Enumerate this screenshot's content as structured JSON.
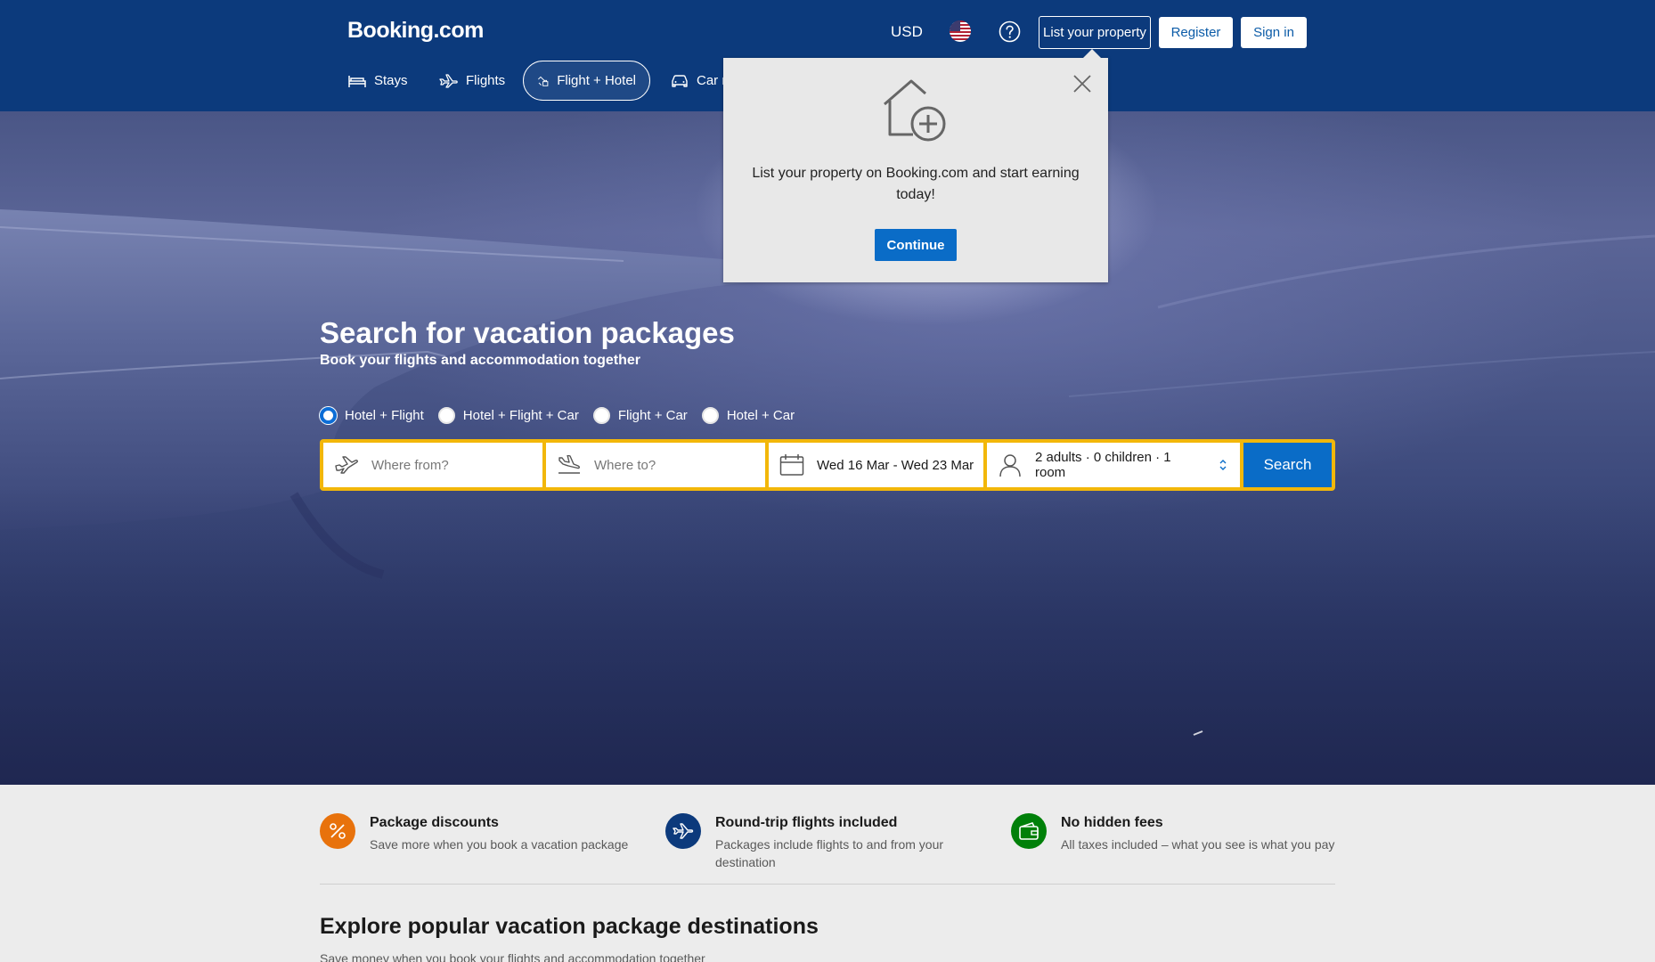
{
  "header": {
    "logo": "Booking.com",
    "currency": "USD",
    "list_property_label": "List your property",
    "register_label": "Register",
    "signin_label": "Sign in"
  },
  "nav": {
    "tabs": [
      {
        "label": "Stays",
        "icon": "bed-icon"
      },
      {
        "label": "Flights",
        "icon": "plane-icon"
      },
      {
        "label": "Flight + Hotel",
        "icon": "flight-hotel-icon",
        "active": true
      },
      {
        "label": "Car r",
        "icon": "car-icon"
      }
    ]
  },
  "popup": {
    "text": "List your property on Booking.com and start earning today!",
    "continue_label": "Continue"
  },
  "hero": {
    "title": "Search for vacation packages",
    "subtitle": "Book your flights and accommodation together",
    "options": [
      "Hotel + Flight",
      "Hotel + Flight + Car",
      "Flight + Car",
      "Hotel + Car"
    ],
    "selected_option": "Hotel + Flight"
  },
  "search": {
    "from_placeholder": "Where from?",
    "to_placeholder": "Where to?",
    "dates": "Wed 16 Mar - Wed 23 Mar",
    "guests": "2 adults · 0 children · 1 room",
    "search_label": "Search"
  },
  "features": [
    {
      "title": "Package discounts",
      "desc": "Save more when you book a vacation package",
      "color": "#e8720c"
    },
    {
      "title": "Round-trip flights included",
      "desc": "Packages include flights to and from your destination",
      "color": "#0c3a7c"
    },
    {
      "title": "No hidden fees",
      "desc": "All taxes included – what you see is what you pay",
      "color": "#008009"
    }
  ],
  "explore": {
    "title": "Explore popular vacation package destinations",
    "subtitle": "Save money when you book your flights and accommodation together"
  }
}
